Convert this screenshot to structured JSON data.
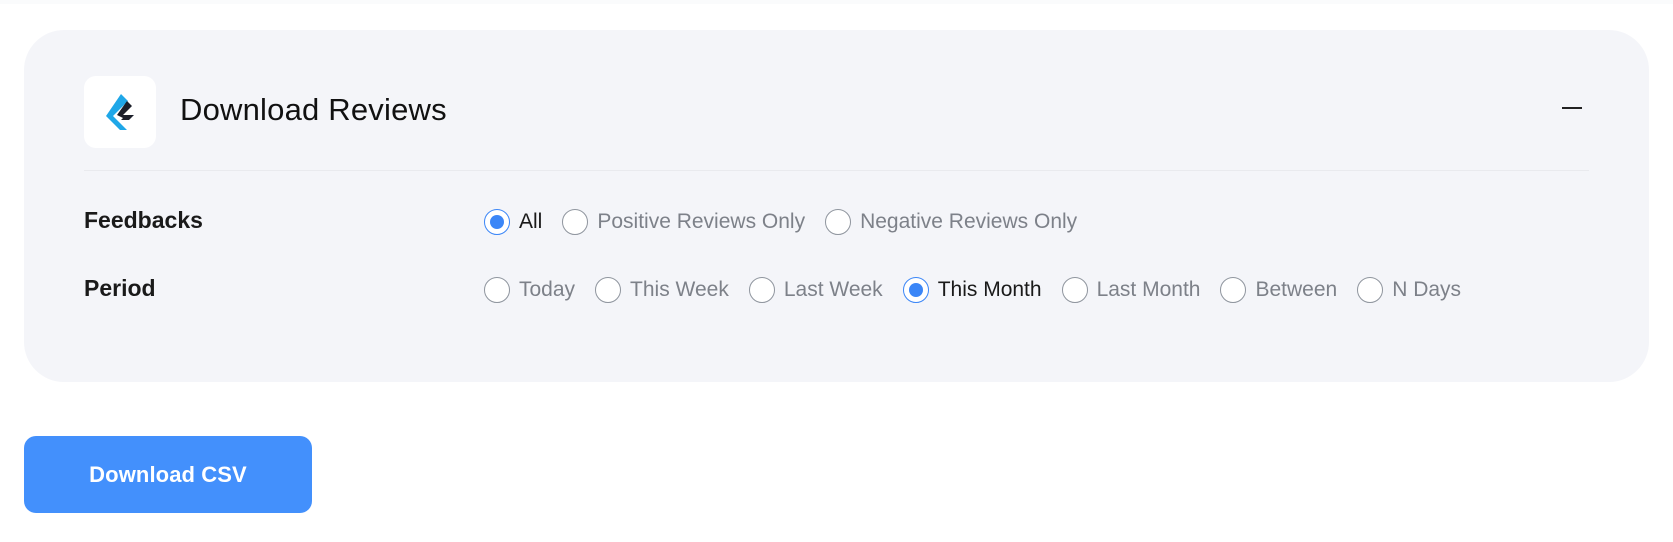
{
  "panel": {
    "title": "Download Reviews",
    "logo_icon": "brand-logo-icon",
    "collapse_icon": "minus-icon"
  },
  "feedbacks": {
    "label": "Feedbacks",
    "options": [
      {
        "label": "All",
        "checked": true
      },
      {
        "label": "Positive Reviews Only",
        "checked": false
      },
      {
        "label": "Negative Reviews Only",
        "checked": false
      }
    ]
  },
  "period": {
    "label": "Period",
    "options": [
      {
        "label": "Today",
        "checked": false
      },
      {
        "label": "This Week",
        "checked": false
      },
      {
        "label": "Last Week",
        "checked": false
      },
      {
        "label": "This Month",
        "checked": true
      },
      {
        "label": "Last Month",
        "checked": false
      },
      {
        "label": "Between",
        "checked": false
      },
      {
        "label": "N Days",
        "checked": false
      }
    ]
  },
  "actions": {
    "download_label": "Download CSV"
  },
  "colors": {
    "accent": "#4390fc",
    "radio_checked": "#3b86f7",
    "panel_bg": "#f4f5f9"
  }
}
